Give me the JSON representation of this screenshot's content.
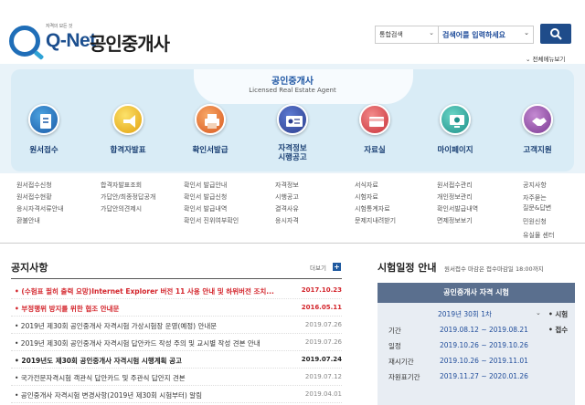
{
  "header": {
    "logo_tagline": "자격의 모든 것",
    "logo_brand": "Q-Net",
    "site_title": "공인중개사",
    "search_scope": "통합검색",
    "search_placeholder": "검색어를 입력하세요",
    "all_menu": "전체메뉴보기"
  },
  "banner": {
    "title": "공인중개사",
    "subtitle": "Licensed Real Estate Agent"
  },
  "main_menu": [
    {
      "label": "원서접수"
    },
    {
      "label": "합격자발표"
    },
    {
      "label": "확인서발급"
    },
    {
      "label": "자격정보\n시행공고"
    },
    {
      "label": "자료실"
    },
    {
      "label": "마이페이지"
    },
    {
      "label": "고객지원"
    }
  ],
  "sub_menus": [
    [
      "원서접수신청",
      "원서접수현황",
      "응시자격서류안내",
      "환불안내"
    ],
    [
      "합격자발표조회",
      "가답안/최종정답공개",
      "가답안의견제시"
    ],
    [
      "확인서 발급안내",
      "확인서 발급신청",
      "확인서 발급내역",
      "확인서 진위여부확인"
    ],
    [
      "자격정보",
      "시행공고",
      "결격사유",
      "응시자격"
    ],
    [
      "서식자료",
      "시험자료",
      "시험통계자료",
      "문제지내려받기"
    ],
    [
      "원서접수관리",
      "개인정보관리",
      "확인서발급내역",
      "면제정보보기"
    ],
    [
      "공지사항",
      "자주묻는",
      "질문&답변",
      "민원신청",
      "유실물 센터"
    ]
  ],
  "notice": {
    "title": "공지사항",
    "more_label": "더보기",
    "more_icon": "plus-icon",
    "items": [
      {
        "text": "• (수험표 필히 출력 요망)Internet Explorer 버전 11 사용 안내 및 하위버전 조치...",
        "date": "2017.10.23",
        "style": "hot"
      },
      {
        "text": "• 부정행위 방지를 위한 협조 안내문",
        "date": "2016.05.11",
        "style": "hot"
      },
      {
        "text": "• 2019년 제30회 공인중개사 자격시험 가상시험장 운영(예정) 안내문",
        "date": "2019.07.26",
        "style": "normal"
      },
      {
        "text": "• 2019년 제30회 공인중개사 자격시험 답안카드 작성 주의 및 교시별 작성 견본 안내",
        "date": "2019.07.26",
        "style": "normal"
      },
      {
        "text": "• 2019년도 제30회 공인중개사 자격시험 시행계획 공고",
        "date": "2019.07.24",
        "style": "bold"
      },
      {
        "text": "• 국가전문자격시험 객관식 답안카드 및 주관식 답안지 견본",
        "date": "2019.07.12",
        "style": "normal"
      },
      {
        "text": "• 공인중개사 자격시험 변경사항(2019년 제30회 시험부터) 알림",
        "date": "2019.04.01",
        "style": "normal"
      }
    ]
  },
  "schedule": {
    "title": "시험일정 안내",
    "note": "원서접수 마감은 접수마감일 18:00까지",
    "box_title": "공인중개사 자격 시험",
    "round": "2019년 30회 1차",
    "rows": [
      {
        "label": "기간",
        "value": "2019.08.12 ~ 2019.08.21"
      },
      {
        "label": "일정",
        "value": "2019.10.26 ~ 2019.10.26"
      },
      {
        "label": "재시기간",
        "value": "2019.10.26 ~ 2019.11.01"
      },
      {
        "label": "자원표기간",
        "value": "2019.11.27 ~ 2020.01.26"
      }
    ],
    "side_labels": [
      "• 시험",
      "• 접수"
    ]
  }
}
